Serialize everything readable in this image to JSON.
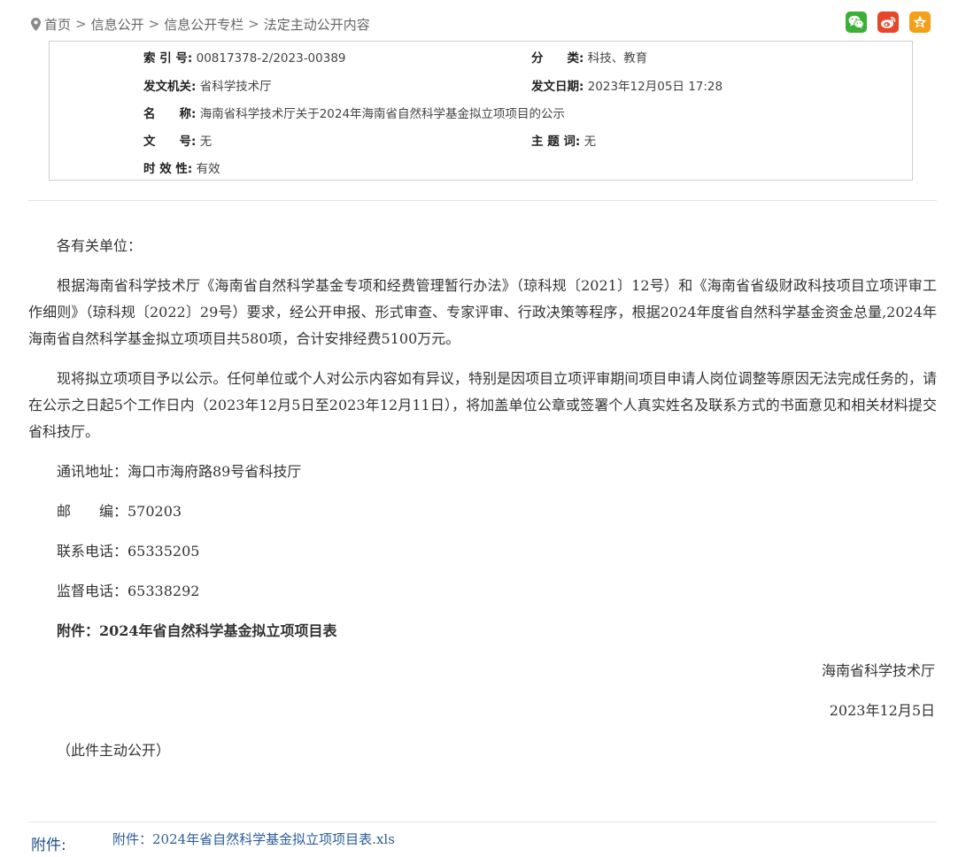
{
  "breadcrumb": {
    "items": [
      "首页",
      "信息公开",
      "信息公开专栏",
      "法定主动公开内容"
    ],
    "separator": ">"
  },
  "share": {
    "wechat": "wechat-icon",
    "weibo": "weibo-icon",
    "qzone": "qzone-star-icon",
    "colors": {
      "wechat": "#3cb034",
      "weibo": "#e6472b",
      "qzone": "#f3a019"
    }
  },
  "meta": {
    "index_label": "索 引 号:",
    "index_value": "00817378-2/2023-00389",
    "category_label": "分　　类:",
    "category_value": "科技、教育",
    "issuer_label": "发文机关:",
    "issuer_value": "省科学技术厅",
    "date_label": "发文日期:",
    "date_value": "2023年12月05日 17:28",
    "name_label": "名　　称:",
    "name_value": "海南省科学技术厅关于2024年海南省自然科学基金拟立项项目的公示",
    "docno_label": "文　　号:",
    "docno_value": "无",
    "subject_label": "主 题 词:",
    "subject_value": "无",
    "validity_label": "时 效 性:",
    "validity_value": "有效"
  },
  "body": {
    "salutation": "各有关单位：",
    "para1": "根据海南省科学技术厅《海南省自然科学基金专项和经费管理暂行办法》（琼科规〔2021〕12号）和《海南省省级财政科技项目立项评审工作细则》（琼科规〔2022〕29号）要求，经公开申报、形式审查、专家评审、行政决策等程序，根据2024年度省自然科学基金资金总量,2024年海南省自然科学基金拟立项项目共580项，合计安排经费5100万元。",
    "para2": "现将拟立项项目予以公示。任何单位或个人对公示内容如有异议，特别是因项目立项评审期间项目申请人岗位调整等原因无法完成任务的，请在公示之日起5个工作日内（2023年12月5日至2023年12月11日），将加盖单位公章或签署个人真实姓名及联系方式的书面意见和相关材料提交省科技厅。",
    "address": "通讯地址：海口市海府路89号省科技厅",
    "zip": "邮　　编：570203",
    "tel": "联系电话：65335205",
    "supervise": "监督电话：65338292",
    "attachment_note": "附件：2024年省自然科学基金拟立项项目表",
    "sign_org": "海南省科学技术厅",
    "sign_date": "2023年12月5日",
    "public_note": "（此件主动公开）"
  },
  "attachments": {
    "label": "附件:",
    "link_text": "附件：2024年省自然科学基金拟立项项目表.xls"
  }
}
